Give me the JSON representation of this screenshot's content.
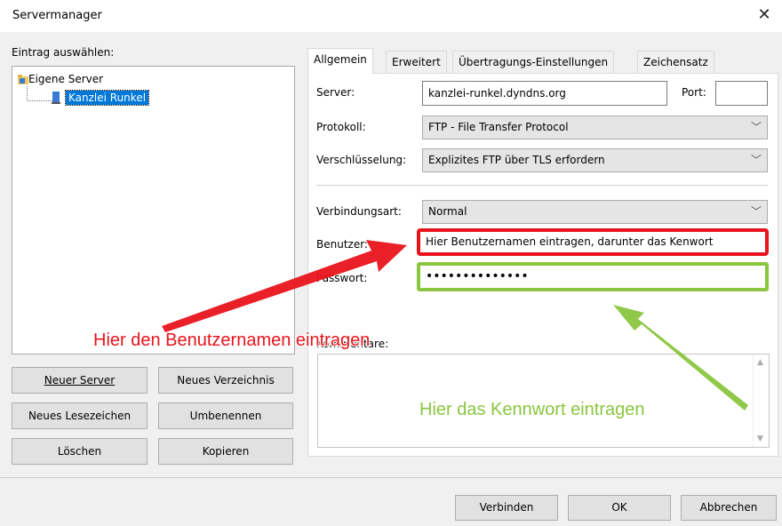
{
  "window": {
    "title": "Servermanager",
    "close_icon": "close-icon"
  },
  "left": {
    "label": "Eintrag auswählen:",
    "tree": {
      "root": "Eigene Server",
      "child": "Kanzlei Runkel"
    },
    "buttons": {
      "new_server": "Neuer Server",
      "new_folder": "Neues Verzeichnis",
      "new_bookmark": "Neues Lesezeichen",
      "rename": "Umbenennen",
      "delete": "Löschen",
      "copy": "Kopieren"
    }
  },
  "tabs": [
    "Allgemein",
    "Erweitert",
    "Übertragungs-Einstellungen",
    "Zeichensatz"
  ],
  "form": {
    "server_label": "Server:",
    "server_value": "kanzlei-runkel.dyndns.org",
    "port_label": "Port:",
    "port_value": "",
    "protocol_label": "Protokoll:",
    "protocol_value": "FTP - File Transfer Protocol",
    "encryption_label": "Verschlüsselung:",
    "encryption_value": "Explizites FTP über TLS erfordern",
    "conntype_label": "Verbindungsart:",
    "conntype_value": "Normal",
    "user_label": "Benutzer:",
    "user_value": "Hier Benutzernamen eintragen, darunter das Kenwort",
    "password_label": "Passwort:",
    "password_value": "••••••••••••••",
    "comments_label": "Kommentare:"
  },
  "footer": {
    "connect": "Verbinden",
    "ok": "OK",
    "cancel": "Abbrechen"
  },
  "annotations": {
    "user_hint": "Hier den Benutzernamen eintragen",
    "password_hint": "Hier das Kennwort eintragen"
  },
  "colors": {
    "highlight_red": "#e8141b",
    "highlight_green": "#8ac63f",
    "selection": "#0078d7"
  }
}
